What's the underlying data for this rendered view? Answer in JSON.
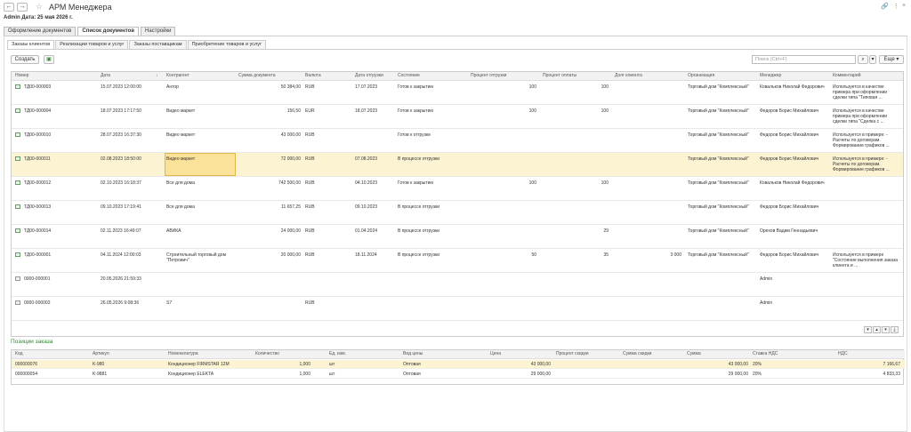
{
  "app": {
    "title": "АРМ Менеджера",
    "user": "Admin",
    "date_label": "Дата: 25 мая 2026 г."
  },
  "main_tabs": [
    "Оформление документов",
    "Список документов",
    "Настройки"
  ],
  "sub_tabs": [
    "Заказы клиентов",
    "Реализации товаров и услуг",
    "Заказы поставщикам",
    "Приобретение товаров и услуг"
  ],
  "toolbar": {
    "create_label": "Создать",
    "search_placeholder": "Поиск (Ctrl+F)",
    "more_label": "Еще"
  },
  "orders": {
    "headers": [
      "Номер",
      "Дата",
      "Контрагент",
      "Сумма документа",
      "Валюта",
      "Дата отгрузки",
      "Состояние",
      "Процент отгрузки",
      "Процент оплаты",
      "Долг клиента",
      "Организация",
      "Менеджер",
      "Комментарий"
    ],
    "rows": [
      {
        "num": "ТД00-000003",
        "date": "15.07.2023 12:00:00",
        "agent": "Антор",
        "sum": "50 384,00",
        "cur": "RUB",
        "ship": "17.07.2023",
        "state": "Готов к закрытию",
        "pship": "100",
        "ppay": "100",
        "debt": "",
        "org": "Торговый дом \"Комплексный\"",
        "mgr": "Ковальков Николай Федорович",
        "comment": "Используется в качестве примера при оформлении сделки типа \"Типовая ..."
      },
      {
        "num": "ТД00-000004",
        "date": "18.07.2023 17:17:50",
        "agent": "Видео маркет",
        "sum": "156,50",
        "cur": "EUR",
        "ship": "18.07.2023",
        "state": "Готов к закрытию",
        "pship": "100",
        "ppay": "100",
        "debt": "",
        "org": "Торговый дом \"Комплексный\"",
        "mgr": "Федоров Борис Михайлович",
        "comment": "Используется в качестве примера при оформлении сделки типа \"Сделка с ..."
      },
      {
        "num": "ТД00-000010",
        "date": "28.07.2023 16:37:30",
        "agent": "Видео маркет",
        "sum": "43 000,00",
        "cur": "RUB",
        "ship": "",
        "state": "Готов к отгрузке",
        "pship": "",
        "ppay": "",
        "debt": "",
        "org": "Торговый дом \"Комплексный\"",
        "mgr": "Федоров Борис Михайлович",
        "comment": "Используется в примере: - Расчеты по договорам. Формирование графиков ..."
      },
      {
        "num": "ТД00-000011",
        "date": "02.08.2023 18:50:00",
        "agent": "Видео маркет",
        "sum": "72 000,00",
        "cur": "RUB",
        "ship": "07.08.2023",
        "state": "В процессе отгрузки",
        "pship": "",
        "ppay": "",
        "debt": "",
        "org": "Торговый дом \"Комплексный\"",
        "mgr": "Федоров Борис Михайлович",
        "comment": "Используется в примере: - Расчеты по договорам. Формирование графиков ..."
      },
      {
        "num": "ТД00-000012",
        "date": "02.10.2023 16:18:37",
        "agent": "Все для дома",
        "sum": "742 500,00",
        "cur": "RUB",
        "ship": "04.10.2023",
        "state": "Готов к закрытию",
        "pship": "100",
        "ppay": "100",
        "debt": "",
        "org": "Торговый дом \"Комплексный\"",
        "mgr": "Ковальков Николай Федорович",
        "comment": ""
      },
      {
        "num": "ТД00-000013",
        "date": "09.10.2023 17:19:41",
        "agent": "Все для дома",
        "sum": "11 657,25",
        "cur": "RUB",
        "ship": "09.10.2023",
        "state": "В процессе отгрузки",
        "pship": "",
        "ppay": "",
        "debt": "",
        "org": "Торговый дом \"Комплексный\"",
        "mgr": "Федоров Борис Михайлович",
        "comment": ""
      },
      {
        "num": "ТД00-000014",
        "date": "02.11.2023 16:49:07",
        "agent": "АВИКА",
        "sum": "24 000,00",
        "cur": "RUB",
        "ship": "01.04.2024",
        "state": "В процессе отгрузки",
        "pship": "",
        "ppay": "29",
        "debt": "",
        "org": "Торговый дом \"Комплексный\"",
        "mgr": "Орехов Вадим Геннадьевич",
        "comment": ""
      },
      {
        "num": "ТД00-000001",
        "date": "04.11.2024 12:00:03",
        "agent": "Строительный торговый дом \"Петрович\"",
        "sum": "20 000,00",
        "cur": "RUB",
        "ship": "18.11.2024",
        "state": "В процессе отгрузки",
        "pship": "50",
        "ppay": "35",
        "debt": "3 000",
        "org": "Торговый дом \"Комплексный\"",
        "mgr": "Федоров Борис Михайлович",
        "comment": "Используется в примере \"Состояние выполнения заказа клиента и ..."
      },
      {
        "num": "0000-000001",
        "date": "20.05.2026 21:59:33",
        "agent": "",
        "sum": "",
        "cur": "",
        "ship": "",
        "state": "",
        "pship": "",
        "ppay": "",
        "debt": "",
        "org": "",
        "mgr": "Admin",
        "comment": ""
      },
      {
        "num": "0000-000002",
        "date": "26.05.2026 9:08:36",
        "agent": "S7",
        "sum": "",
        "cur": "RUB",
        "ship": "",
        "state": "",
        "pship": "",
        "ppay": "",
        "debt": "",
        "org": "",
        "mgr": "Admin",
        "comment": ""
      }
    ]
  },
  "positions": {
    "title": "Позиции заказа",
    "headers": [
      "Код",
      "Артикул",
      "Номенклатура",
      "Количество",
      "Ед. изм.",
      "Вид цены",
      "Цена",
      "Процент скидки",
      "Сумма скидки",
      "Сумма",
      "Ставка НДС",
      "НДС"
    ],
    "rows": [
      {
        "code": "000000076",
        "art": "K-980",
        "name": "Кондиционер FIRMSTAR 12M",
        "qty": "1,000",
        "unit": "шт",
        "ptype": "Оптовая",
        "price": "43 000,00",
        "disc": "",
        "dsum": "",
        "sum": "43 000,00",
        "rate": "20%",
        "vat": "7 166,67"
      },
      {
        "code": "000000054",
        "art": "K-9881",
        "name": "Кондиционер ELEKTA",
        "qty": "1,000",
        "unit": "шт",
        "ptype": "Оптовая",
        "price": "29 000,00",
        "disc": "",
        "dsum": "",
        "sum": "29 000,00",
        "rate": "20%",
        "vat": "4 833,33"
      }
    ]
  }
}
